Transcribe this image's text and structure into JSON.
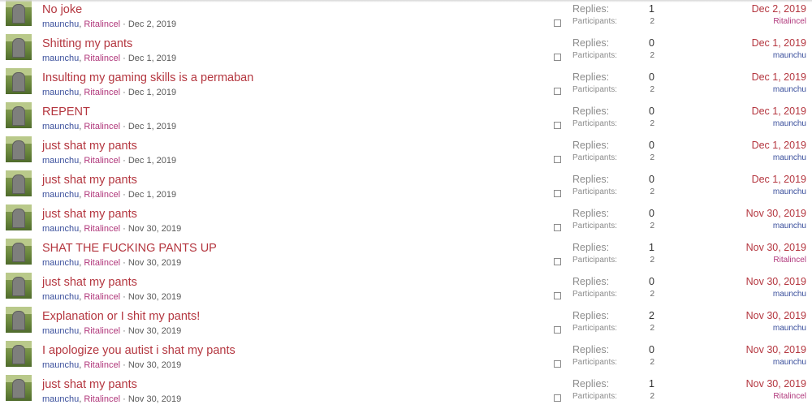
{
  "labels": {
    "replies": "Replies:",
    "participants": "Participants:",
    "separator": "·",
    "comma": ","
  },
  "threads": [
    {
      "title": "No joke",
      "starter": "maunchu",
      "recipient": "Ritalincel",
      "date": "Dec 2, 2019",
      "replies": "1",
      "participants": "2",
      "last_date": "Dec 2, 2019",
      "last_user": "Ritalincel"
    },
    {
      "title": "Shitting my pants",
      "starter": "maunchu",
      "recipient": "Ritalincel",
      "date": "Dec 1, 2019",
      "replies": "0",
      "participants": "2",
      "last_date": "Dec 1, 2019",
      "last_user": "maunchu"
    },
    {
      "title": "Insulting my gaming skills is a permaban",
      "starter": "maunchu",
      "recipient": "Ritalincel",
      "date": "Dec 1, 2019",
      "replies": "0",
      "participants": "2",
      "last_date": "Dec 1, 2019",
      "last_user": "maunchu"
    },
    {
      "title": "REPENT",
      "starter": "maunchu",
      "recipient": "Ritalincel",
      "date": "Dec 1, 2019",
      "replies": "0",
      "participants": "2",
      "last_date": "Dec 1, 2019",
      "last_user": "maunchu"
    },
    {
      "title": "just shat my pants",
      "starter": "maunchu",
      "recipient": "Ritalincel",
      "date": "Dec 1, 2019",
      "replies": "0",
      "participants": "2",
      "last_date": "Dec 1, 2019",
      "last_user": "maunchu"
    },
    {
      "title": "just shat my pants",
      "starter": "maunchu",
      "recipient": "Ritalincel",
      "date": "Dec 1, 2019",
      "replies": "0",
      "participants": "2",
      "last_date": "Dec 1, 2019",
      "last_user": "maunchu"
    },
    {
      "title": "just shat my pants",
      "starter": "maunchu",
      "recipient": "Ritalincel",
      "date": "Nov 30, 2019",
      "replies": "0",
      "participants": "2",
      "last_date": "Nov 30, 2019",
      "last_user": "maunchu"
    },
    {
      "title": "SHAT THE FUCKING PANTS UP",
      "starter": "maunchu",
      "recipient": "Ritalincel",
      "date": "Nov 30, 2019",
      "replies": "1",
      "participants": "2",
      "last_date": "Nov 30, 2019",
      "last_user": "Ritalincel"
    },
    {
      "title": "just shat my pants",
      "starter": "maunchu",
      "recipient": "Ritalincel",
      "date": "Nov 30, 2019",
      "replies": "0",
      "participants": "2",
      "last_date": "Nov 30, 2019",
      "last_user": "maunchu"
    },
    {
      "title": "Explanation or I shit my pants!",
      "starter": "maunchu",
      "recipient": "Ritalincel",
      "date": "Nov 30, 2019",
      "replies": "2",
      "participants": "2",
      "last_date": "Nov 30, 2019",
      "last_user": "maunchu"
    },
    {
      "title": "I apologize you autist i shat my pants",
      "starter": "maunchu",
      "recipient": "Ritalincel",
      "date": "Nov 30, 2019",
      "replies": "0",
      "participants": "2",
      "last_date": "Nov 30, 2019",
      "last_user": "maunchu"
    },
    {
      "title": "just shat my pants",
      "starter": "maunchu",
      "recipient": "Ritalincel",
      "date": "Nov 30, 2019",
      "replies": "1",
      "participants": "2",
      "last_date": "Nov 30, 2019",
      "last_user": "Ritalincel"
    }
  ],
  "colors": {
    "title": "#b4363f",
    "starter": "#3a4f9c",
    "recipient": "#b0367a"
  }
}
